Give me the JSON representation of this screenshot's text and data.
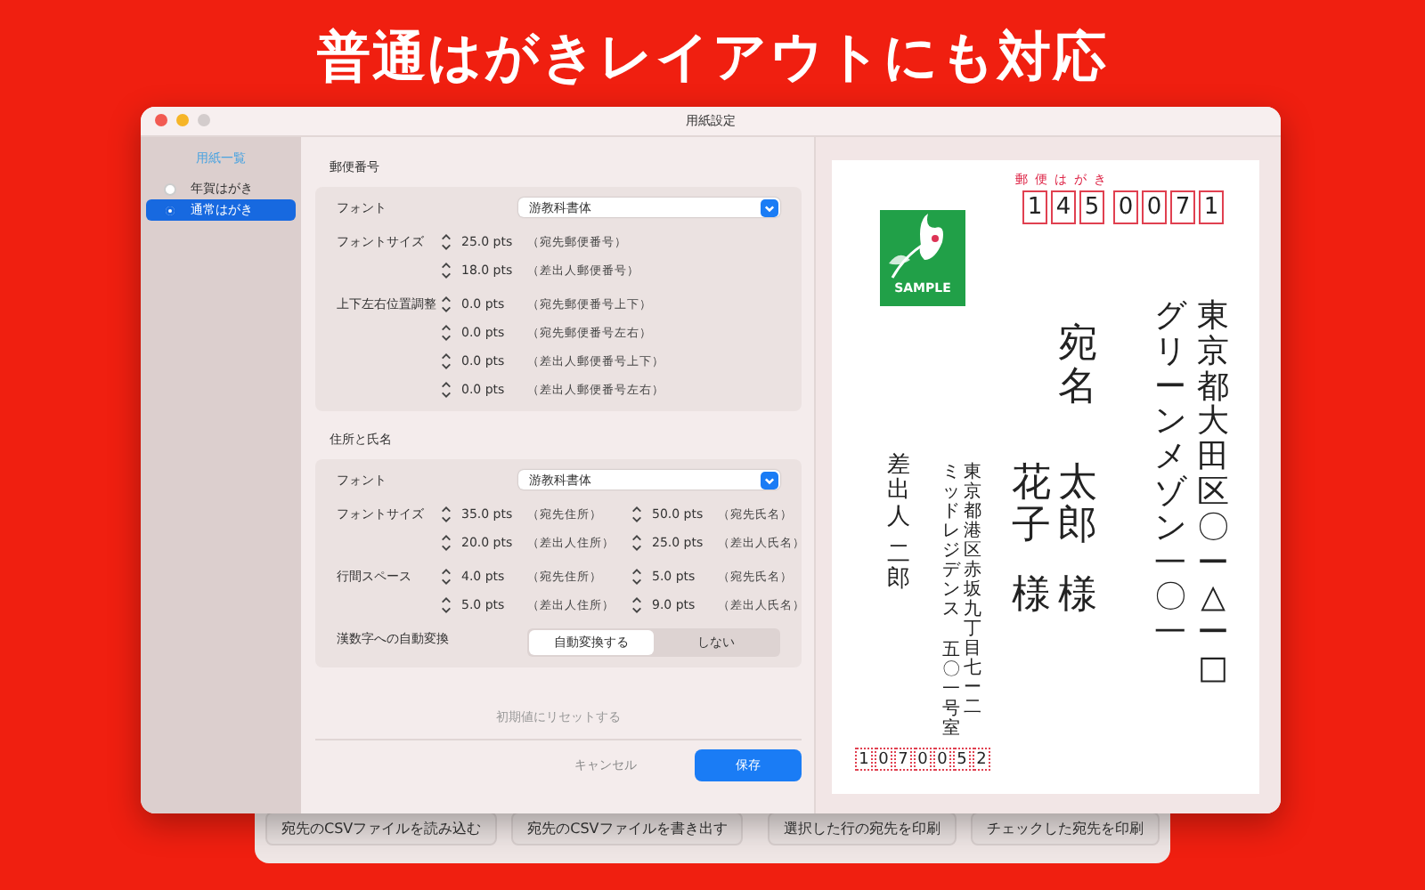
{
  "headline": "普通はがきレイアウトにも対応",
  "window": {
    "title": "用紙設定"
  },
  "sidebar": {
    "heading": "用紙一覧",
    "items": [
      {
        "label": "年賀はがき",
        "selected": false
      },
      {
        "label": "通常はがき",
        "selected": true
      }
    ]
  },
  "sections": [
    {
      "title": "郵便番号",
      "rows": [
        {
          "kind": "select",
          "label": "フォント",
          "value": "游教科書体"
        },
        {
          "kind": "steppers",
          "label": "フォントサイズ",
          "lines": [
            [
              {
                "value": "25.0 pts",
                "note": "（宛先郵便番号）"
              }
            ],
            [
              {
                "value": "18.0 pts",
                "note": "（差出人郵便番号）"
              }
            ]
          ]
        },
        {
          "kind": "steppers",
          "label": "上下左右位置調整",
          "lines": [
            [
              {
                "value": "0.0 pts",
                "note": "（宛先郵便番号上下）"
              }
            ],
            [
              {
                "value": "0.0 pts",
                "note": "（宛先郵便番号左右）"
              }
            ],
            [
              {
                "value": "0.0 pts",
                "note": "（差出人郵便番号上下）"
              }
            ],
            [
              {
                "value": "0.0 pts",
                "note": "（差出人郵便番号左右）"
              }
            ]
          ]
        }
      ]
    },
    {
      "title": "住所と氏名",
      "rows": [
        {
          "kind": "select",
          "label": "フォント",
          "value": "游教科書体"
        },
        {
          "kind": "steppers",
          "label": "フォントサイズ",
          "lines": [
            [
              {
                "value": "35.0 pts",
                "note": "（宛先住所）"
              },
              {
                "value": "50.0 pts",
                "note": "（宛先氏名）"
              }
            ],
            [
              {
                "value": "20.0 pts",
                "note": "（差出人住所）"
              },
              {
                "value": "25.0 pts",
                "note": "（差出人氏名）"
              }
            ]
          ]
        },
        {
          "kind": "steppers",
          "label": "行間スペース",
          "lines": [
            [
              {
                "value": "4.0 pts",
                "note": "（宛先住所）"
              },
              {
                "value": "5.0 pts",
                "note": "（宛先氏名）"
              }
            ],
            [
              {
                "value": "5.0 pts",
                "note": "（差出人住所）"
              },
              {
                "value": "9.0 pts",
                "note": "（差出人氏名）"
              }
            ]
          ]
        },
        {
          "kind": "segmented",
          "label": "漢数字への自動変換",
          "options": [
            {
              "label": "自動変換する",
              "selected": true
            },
            {
              "label": "しない",
              "selected": false
            }
          ]
        }
      ]
    }
  ],
  "reset_link": "初期値にリセットする",
  "buttons": [
    {
      "kind": "plain",
      "label": "キャンセル"
    },
    {
      "kind": "primary",
      "label": "保存"
    }
  ],
  "postcard": {
    "header": "郵便はがき",
    "stamp_label": "SAMPLE",
    "recipient_zip": [
      "1",
      "4",
      "5",
      "0",
      "0",
      "7",
      "1"
    ],
    "recipient_address": {
      "street": "東京都大田区〇ー△ー□",
      "building": "グリーンメゾン一〇一"
    },
    "recipient_surname": "宛名",
    "recipient_person": {
      "given_name": "太郎",
      "honorific": "様"
    },
    "recipient_partner": {
      "given_name": "花子",
      "honorific": "様"
    },
    "sender_address": {
      "street": "東京都港区赤坂九丁目七ー二",
      "building": "ミッドレジデンス",
      "room": "五〇一号室"
    },
    "sender_surname": "差出人",
    "sender_given_name": "二郎",
    "sender_zip": [
      "1",
      "0",
      "7",
      "0",
      "0",
      "5",
      "2"
    ]
  },
  "back_window": {
    "buttons": [
      {
        "label": "宛先のCSVファイルを読み込む"
      },
      {
        "label": "宛先のCSVファイルを書き出す"
      },
      {
        "label": "選択した行の宛先を印刷"
      },
      {
        "label": "チェックした宛先を印刷"
      }
    ]
  }
}
